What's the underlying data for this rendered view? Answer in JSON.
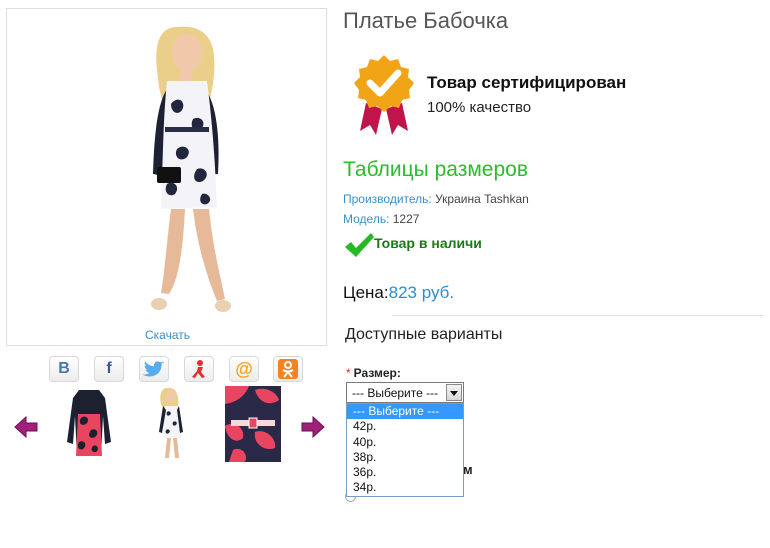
{
  "product": {
    "title": "Платье Бабочка",
    "download_label": "Скачать"
  },
  "certificate": {
    "title": "Товар сертифицирован",
    "subtitle": "100% качество",
    "badge_icon": "certificate-badge-icon"
  },
  "size_table_link": "Таблицы размеров",
  "meta": {
    "manufacturer_label": "Производитель:",
    "manufacturer_value": " Украина Tashkan",
    "model_label": "Модель:",
    "model_value": " 1227"
  },
  "stock_status": "Товар в наличи",
  "price": {
    "label": "Цена:",
    "value": "823 руб."
  },
  "options": {
    "title": "Доступные варианты",
    "size_label": "Размер:",
    "required_mark": "*",
    "selected": "--- Выберите ---",
    "dropdown_items": [
      "--- Выберите ---",
      "42р.",
      "40р.",
      "38р.",
      "36р.",
      "34р."
    ]
  },
  "hidden_fragment": "м",
  "social": {
    "icons": [
      {
        "name": "vk-icon",
        "glyph": "B",
        "color": "#4a76a8"
      },
      {
        "name": "facebook-icon",
        "glyph": "f",
        "color": "#3b5998"
      },
      {
        "name": "twitter-icon",
        "glyph": "",
        "color": "#55acee"
      },
      {
        "name": "yaru-icon",
        "glyph": "",
        "color": "#e03030"
      },
      {
        "name": "mailru-icon",
        "glyph": "@",
        "color": "#f7a31a"
      },
      {
        "name": "odnoklassniki-icon",
        "glyph": "",
        "color": "#f58220"
      }
    ]
  },
  "colors": {
    "accent_blue": "#3a8fc8",
    "accent_green": "#2dbb2d",
    "stock_green": "#1a7a1a",
    "arrow_purple": "#a0207a"
  }
}
